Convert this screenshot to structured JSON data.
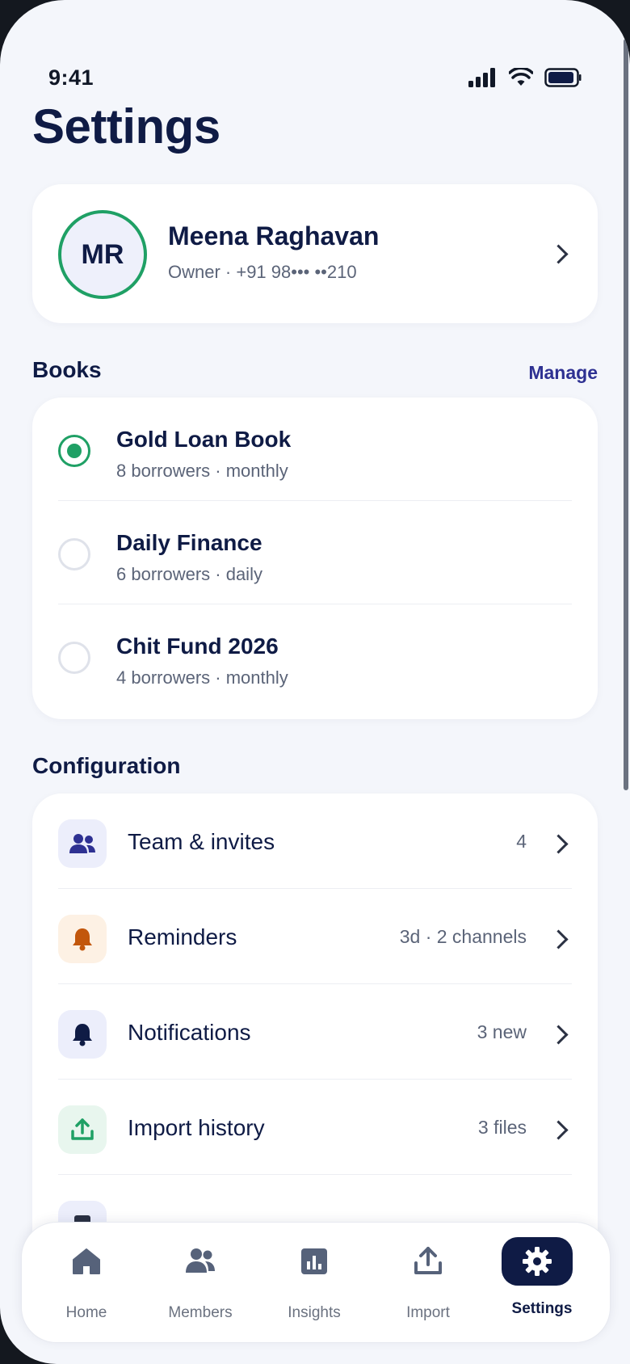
{
  "status_bar": {
    "time": "9:41"
  },
  "page": {
    "title": "Settings"
  },
  "profile": {
    "initials": "MR",
    "name": "Meena Raghavan",
    "subtitle": "Owner · +91 98••• ••210"
  },
  "books": {
    "title": "Books",
    "action": "Manage",
    "items": [
      {
        "name": "Gold Loan Book",
        "meta": "8 borrowers · monthly",
        "selected": true
      },
      {
        "name": "Daily Finance",
        "meta": "6 borrowers · daily",
        "selected": false
      },
      {
        "name": "Chit Fund 2026",
        "meta": "4 borrowers · monthly",
        "selected": false
      }
    ]
  },
  "configuration": {
    "title": "Configuration",
    "items": [
      {
        "label": "Team & invites",
        "value": "4",
        "icon": "team-icon"
      },
      {
        "label": "Reminders",
        "value": "3d · 2 channels",
        "icon": "bell-icon"
      },
      {
        "label": "Notifications",
        "value": "3 new",
        "icon": "bell-icon"
      },
      {
        "label": "Import history",
        "value": "3 files",
        "icon": "upload-icon"
      }
    ]
  },
  "tabs": [
    {
      "label": "Home",
      "icon": "home-icon"
    },
    {
      "label": "Members",
      "icon": "members-icon"
    },
    {
      "label": "Insights",
      "icon": "chart-icon"
    },
    {
      "label": "Import",
      "icon": "upload-icon"
    },
    {
      "label": "Settings",
      "icon": "gear-icon",
      "active": true
    }
  ],
  "colors": {
    "navy": "#0f1b45",
    "green": "#1fa065",
    "indigo": "#2e3192",
    "orange": "#c2570c",
    "background": "#f4f6fb"
  }
}
